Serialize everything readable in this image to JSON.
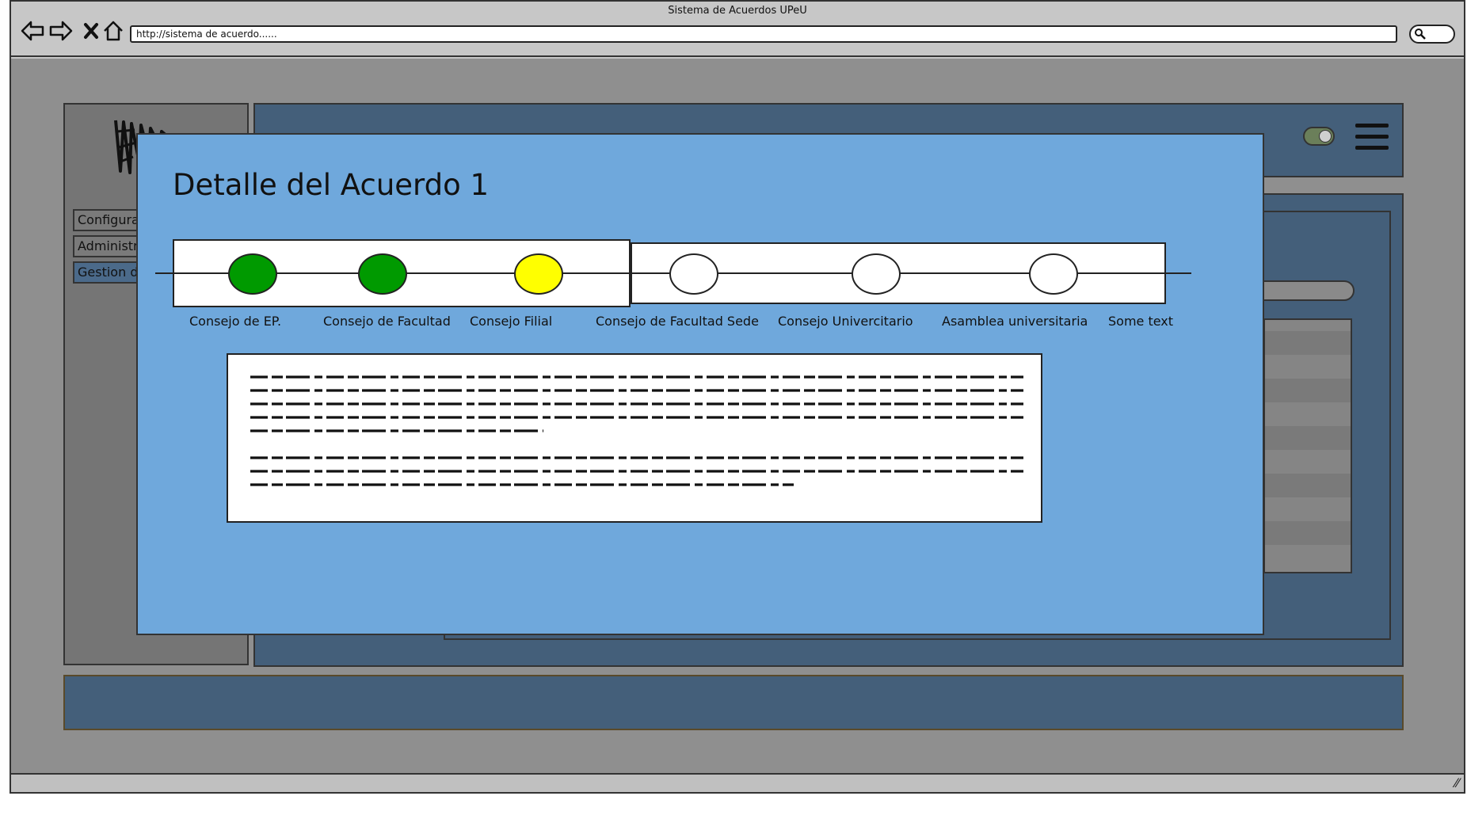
{
  "browser": {
    "window_title": "Sistema de Acuerdos UPeU",
    "url": "http://sistema de acuerdo......"
  },
  "sidebar": {
    "items": [
      {
        "label": "Configuraciones"
      },
      {
        "label": "Administracion"
      },
      {
        "label": "Gestion de Acuerdos"
      }
    ]
  },
  "modal": {
    "title": "Detalle del Acuerdo 1",
    "steps": [
      {
        "label": "Consejo de EP.",
        "status": "done",
        "color": "#009a00"
      },
      {
        "label": "Consejo de Facultad",
        "status": "done",
        "color": "#009a00"
      },
      {
        "label": "Consejo Filial",
        "status": "current",
        "color": "#ffff00"
      },
      {
        "label": "Consejo de Facultad Sede",
        "status": "pending",
        "color": "#ffffff"
      },
      {
        "label": "Consejo Univercitario",
        "status": "pending",
        "color": "#ffffff"
      },
      {
        "label": "Asamblea universitaria",
        "status": "pending",
        "color": "#ffffff"
      },
      {
        "label": "Some text",
        "status": "pending",
        "color": ""
      }
    ]
  },
  "colors": {
    "modal_bg": "#6fa8dc",
    "app_dark_blue": "#445f7a",
    "overlay_gray": "#8f8f8f"
  },
  "icons": {
    "back": "arrow-left-icon",
    "forward": "arrow-right-icon",
    "stop": "close-icon",
    "home": "home-icon",
    "search": "search-icon",
    "menu": "hamburger-menu-icon"
  }
}
